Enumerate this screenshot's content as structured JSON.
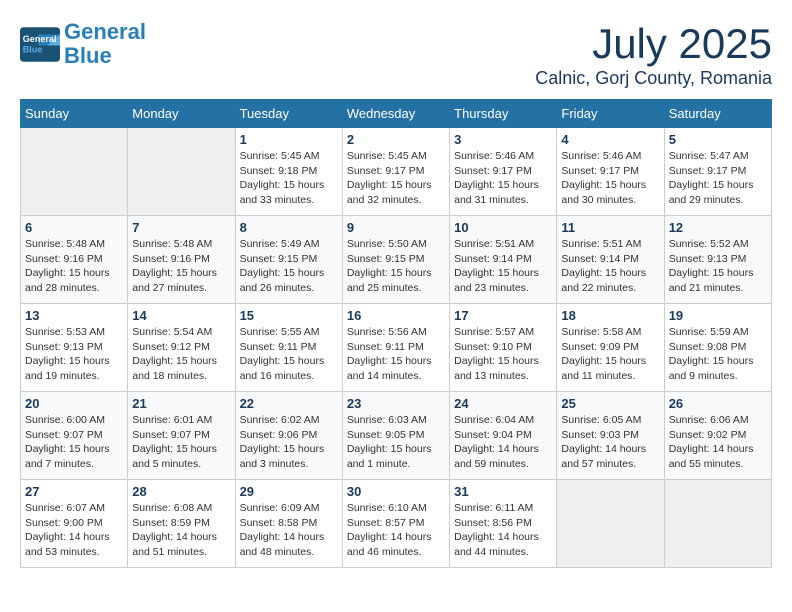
{
  "header": {
    "logo_line1": "General",
    "logo_line2": "Blue",
    "month": "July 2025",
    "location": "Calnic, Gorj County, Romania"
  },
  "weekdays": [
    "Sunday",
    "Monday",
    "Tuesday",
    "Wednesday",
    "Thursday",
    "Friday",
    "Saturday"
  ],
  "weeks": [
    [
      {
        "day": "",
        "info": ""
      },
      {
        "day": "",
        "info": ""
      },
      {
        "day": "1",
        "sunrise": "5:45 AM",
        "sunset": "9:18 PM",
        "daylight": "15 hours and 33 minutes."
      },
      {
        "day": "2",
        "sunrise": "5:45 AM",
        "sunset": "9:17 PM",
        "daylight": "15 hours and 32 minutes."
      },
      {
        "day": "3",
        "sunrise": "5:46 AM",
        "sunset": "9:17 PM",
        "daylight": "15 hours and 31 minutes."
      },
      {
        "day": "4",
        "sunrise": "5:46 AM",
        "sunset": "9:17 PM",
        "daylight": "15 hours and 30 minutes."
      },
      {
        "day": "5",
        "sunrise": "5:47 AM",
        "sunset": "9:17 PM",
        "daylight": "15 hours and 29 minutes."
      }
    ],
    [
      {
        "day": "6",
        "sunrise": "5:48 AM",
        "sunset": "9:16 PM",
        "daylight": "15 hours and 28 minutes."
      },
      {
        "day": "7",
        "sunrise": "5:48 AM",
        "sunset": "9:16 PM",
        "daylight": "15 hours and 27 minutes."
      },
      {
        "day": "8",
        "sunrise": "5:49 AM",
        "sunset": "9:15 PM",
        "daylight": "15 hours and 26 minutes."
      },
      {
        "day": "9",
        "sunrise": "5:50 AM",
        "sunset": "9:15 PM",
        "daylight": "15 hours and 25 minutes."
      },
      {
        "day": "10",
        "sunrise": "5:51 AM",
        "sunset": "9:14 PM",
        "daylight": "15 hours and 23 minutes."
      },
      {
        "day": "11",
        "sunrise": "5:51 AM",
        "sunset": "9:14 PM",
        "daylight": "15 hours and 22 minutes."
      },
      {
        "day": "12",
        "sunrise": "5:52 AM",
        "sunset": "9:13 PM",
        "daylight": "15 hours and 21 minutes."
      }
    ],
    [
      {
        "day": "13",
        "sunrise": "5:53 AM",
        "sunset": "9:13 PM",
        "daylight": "15 hours and 19 minutes."
      },
      {
        "day": "14",
        "sunrise": "5:54 AM",
        "sunset": "9:12 PM",
        "daylight": "15 hours and 18 minutes."
      },
      {
        "day": "15",
        "sunrise": "5:55 AM",
        "sunset": "9:11 PM",
        "daylight": "15 hours and 16 minutes."
      },
      {
        "day": "16",
        "sunrise": "5:56 AM",
        "sunset": "9:11 PM",
        "daylight": "15 hours and 14 minutes."
      },
      {
        "day": "17",
        "sunrise": "5:57 AM",
        "sunset": "9:10 PM",
        "daylight": "15 hours and 13 minutes."
      },
      {
        "day": "18",
        "sunrise": "5:58 AM",
        "sunset": "9:09 PM",
        "daylight": "15 hours and 11 minutes."
      },
      {
        "day": "19",
        "sunrise": "5:59 AM",
        "sunset": "9:08 PM",
        "daylight": "15 hours and 9 minutes."
      }
    ],
    [
      {
        "day": "20",
        "sunrise": "6:00 AM",
        "sunset": "9:07 PM",
        "daylight": "15 hours and 7 minutes."
      },
      {
        "day": "21",
        "sunrise": "6:01 AM",
        "sunset": "9:07 PM",
        "daylight": "15 hours and 5 minutes."
      },
      {
        "day": "22",
        "sunrise": "6:02 AM",
        "sunset": "9:06 PM",
        "daylight": "15 hours and 3 minutes."
      },
      {
        "day": "23",
        "sunrise": "6:03 AM",
        "sunset": "9:05 PM",
        "daylight": "15 hours and 1 minute."
      },
      {
        "day": "24",
        "sunrise": "6:04 AM",
        "sunset": "9:04 PM",
        "daylight": "14 hours and 59 minutes."
      },
      {
        "day": "25",
        "sunrise": "6:05 AM",
        "sunset": "9:03 PM",
        "daylight": "14 hours and 57 minutes."
      },
      {
        "day": "26",
        "sunrise": "6:06 AM",
        "sunset": "9:02 PM",
        "daylight": "14 hours and 55 minutes."
      }
    ],
    [
      {
        "day": "27",
        "sunrise": "6:07 AM",
        "sunset": "9:00 PM",
        "daylight": "14 hours and 53 minutes."
      },
      {
        "day": "28",
        "sunrise": "6:08 AM",
        "sunset": "8:59 PM",
        "daylight": "14 hours and 51 minutes."
      },
      {
        "day": "29",
        "sunrise": "6:09 AM",
        "sunset": "8:58 PM",
        "daylight": "14 hours and 48 minutes."
      },
      {
        "day": "30",
        "sunrise": "6:10 AM",
        "sunset": "8:57 PM",
        "daylight": "14 hours and 46 minutes."
      },
      {
        "day": "31",
        "sunrise": "6:11 AM",
        "sunset": "8:56 PM",
        "daylight": "14 hours and 44 minutes."
      },
      {
        "day": "",
        "info": ""
      },
      {
        "day": "",
        "info": ""
      }
    ]
  ]
}
